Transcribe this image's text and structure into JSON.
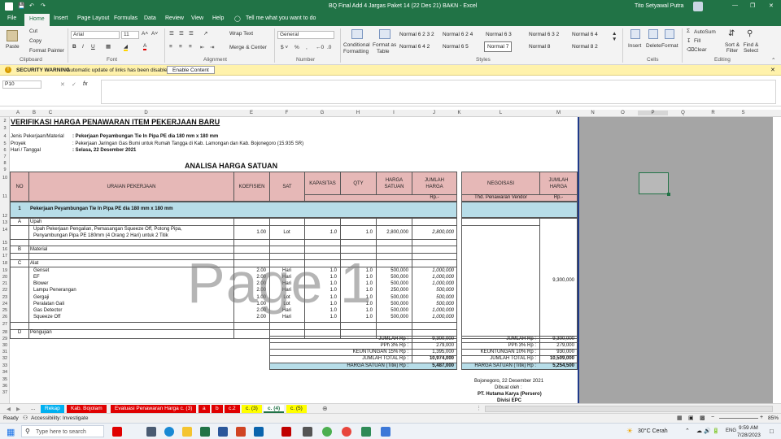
{
  "titlebar": {
    "doc_title": "BQ Final Add 4 Jargas Paket 14 (22 Des 21)  BAKN  -  Excel",
    "user": "Tito Setyawal Putra"
  },
  "menu": {
    "tabs": [
      "File",
      "Home",
      "Insert",
      "Page Layout",
      "Formulas",
      "Data",
      "Review",
      "View",
      "Help"
    ],
    "tell_me": "Tell me what you want to do"
  },
  "ribbon": {
    "paste": "Paste",
    "cut": "Cut",
    "copy": "Copy",
    "format_painter": "Format Painter",
    "clipboard": "Clipboard",
    "font_name": "Arial",
    "font_size": "11",
    "font": "Font",
    "wrap_text": "Wrap Text",
    "merge_center": "Merge & Center",
    "alignment": "Alignment",
    "number_format": "General",
    "number": "Number",
    "conditional": "Conditional",
    "formatting": "Formatting",
    "format_as": "Format as",
    "table": "Table",
    "styles_list": [
      "Normal 6 2 3 2",
      "Normal 6 2 4",
      "Normal 6 3",
      "Normal 6 3 2",
      "Normal 6 4",
      "Normal 6 4 2",
      "Normal 6 5",
      "Normal 7",
      "Normal 8",
      "Normal 8 2"
    ],
    "styles": "Styles",
    "insert": "Insert",
    "delete": "Delete",
    "format": "Format",
    "cells": "Cells",
    "autosum": "AutoSum",
    "fill": "Fill",
    "clear": "Clear",
    "sort_filter": "Sort & Filter",
    "find_select": "Find & Select",
    "editing": "Editing"
  },
  "warning": {
    "label": "SECURITY WARNING",
    "message": "Automatic update of links has been disabled",
    "button": "Enable Content"
  },
  "formula_bar": {
    "name_box": "P10",
    "fx": "fx",
    "content": ""
  },
  "columns": [
    "A",
    "B",
    "C",
    "D",
    "E",
    "F",
    "G",
    "H",
    "I",
    "J",
    "K",
    "L",
    "M",
    "N",
    "O",
    "P",
    "Q",
    "R",
    "S"
  ],
  "rows": [
    "2",
    "3",
    "4",
    "5",
    "6",
    "7",
    "8",
    "9",
    "10",
    "11",
    "12",
    "13",
    "14",
    "15",
    "16",
    "17",
    "18",
    "19",
    "20",
    "21",
    "22",
    "23",
    "24",
    "25",
    "26",
    "27",
    "28",
    "29",
    "30",
    "31",
    "32",
    "33",
    "34",
    "35",
    "36",
    "37"
  ],
  "doc": {
    "title": "VERIFIKASI HARGA PENAWARAN ITEM PEKERJAAN BARU",
    "jenis_label": "Jenis Pekerjaan/Material",
    "jenis_value": ": Pekerjaan Peyambungan Tie In Pipa PE dia 180 mm x 180 mm",
    "proyek_label": "Proyek",
    "proyek_value": ": Pekerjaan Jaringan Gas Bumi untuk Rumah Tangga di Kab. Lamongan dan Kab. Bojonegoro (15.935 SR)",
    "hari_label": "Hari / Tanggal",
    "hari_value": ": Selasa, 22 Desember 2021",
    "analisa": "ANALISA HARGA SATUAN",
    "h_no": "NO",
    "h_uraian": "URAIAN PEKERJAAN",
    "h_koef": "KOEFISIEN",
    "h_sat": "SAT",
    "h_kap": "KAPASITAS",
    "h_qty": "QTY",
    "h_harga": "HARGA SATUAN",
    "h_jumlah": "JUMLAH HARGA",
    "h_rp": "Rp.-",
    "h_negosiasi": "NEGOISASI",
    "h_jumlah2": "JUMLAH HARGA",
    "h_thd": "Thd. Penawaran Vendor",
    "h_rp2": "Rp.-",
    "item_no": "1",
    "item_name": "Pekerjaan Peyambungan Tie In Pipa PE dia 180 mm x 180 mm",
    "a_label": "A",
    "a_name": "Upah",
    "upah_desc1": "Upah Pekerjaan Pengalian, Pemasangan Squeeze Off, Potong Pipa,",
    "upah_desc2": "Penyambungan Pipa PE 180mm (4 Orang 2 Hari) untuk 2 Titik",
    "upah_koef": "1.00",
    "upah_sat": "Lot",
    "upah_kap": "1.0",
    "upah_qty": "1.0",
    "upah_harga": "2,800,000",
    "upah_jumlah": "2,800,000",
    "b_label": "B",
    "b_name": "Material",
    "c_label": "C",
    "c_name": "Alat",
    "d_label": "D",
    "d_name": "Pengujian",
    "alat": [
      {
        "name": "Genset",
        "koef": "2.00",
        "sat": "Hari",
        "kap": "1.0",
        "qty": "1.0",
        "harga": "500,000",
        "jumlah": "1,000,000"
      },
      {
        "name": "EF",
        "koef": "2.00",
        "sat": "Hari",
        "kap": "1.0",
        "qty": "1.0",
        "harga": "500,000",
        "jumlah": "1,000,000"
      },
      {
        "name": "Blower",
        "koef": "2.00",
        "sat": "Hari",
        "kap": "1.0",
        "qty": "1.0",
        "harga": "500,000",
        "jumlah": "1,000,000"
      },
      {
        "name": "Lampu Penerangan",
        "koef": "2.00",
        "sat": "Hari",
        "kap": "1.0",
        "qty": "1.0",
        "harga": "250,000",
        "jumlah": "500,000"
      },
      {
        "name": "Gergaji",
        "koef": "1.00",
        "sat": "Lot",
        "kap": "1.0",
        "qty": "1.0",
        "harga": "500,000",
        "jumlah": "500,000"
      },
      {
        "name": "Peralatan Gali",
        "koef": "1.00",
        "sat": "Lot",
        "kap": "1.0",
        "qty": "1.0",
        "harga": "500,000",
        "jumlah": "500,000"
      },
      {
        "name": "Gas Detector",
        "koef": "2.00",
        "sat": "Hari",
        "kap": "1.0",
        "qty": "1.0",
        "harga": "500,000",
        "jumlah": "1,000,000"
      },
      {
        "name": "Squeeze Off",
        "koef": "2.00",
        "sat": "Hari",
        "kap": "1.0",
        "qty": "1.0",
        "harga": "500,000",
        "jumlah": "1,000,000"
      }
    ],
    "nego_value": "9,300,000",
    "sum_left": [
      {
        "label": "JUMLAH Rp :",
        "value": "9,300,000"
      },
      {
        "label": "PPh 3% Rp :",
        "value": "279,000"
      },
      {
        "label": "KEUNTUNGAN 15% Rp :",
        "value": "1,395,000"
      },
      {
        "label": "JUMLAH TOTAL Rp :",
        "value": "10,974,000"
      },
      {
        "label": "HARGA SATUAN (Titik) Rp :",
        "value": "5,487,000"
      }
    ],
    "sum_right": [
      {
        "label": "JUMLAH Rp :",
        "value": "9,300,000"
      },
      {
        "label": "PPh 3% Rp :",
        "value": "279,000"
      },
      {
        "label": "KEUNTUNGAN 10% Rp :",
        "value": "930,000"
      },
      {
        "label": "JUMLAH TOTAL Rp :",
        "value": "10,509,000"
      },
      {
        "label": "HARGA SATUAN (Titik) Rp :",
        "value": "5,254,500"
      }
    ],
    "sign_date": "Bojonegoro, 22 Desember 2021",
    "sign_by": "Dibuat oleh :",
    "sign_company": "PT. Hutama Karya (Persero)",
    "sign_div": "Divisi EPC"
  },
  "watermark": "Page 1",
  "sheet_tabs": [
    "...",
    "Rekap",
    "Kab. Bojolam",
    "Evaluasi Penawaran Harga c. (3)",
    "a",
    "b",
    "c.2",
    "c. (3)",
    "c. (4)",
    "c. (5)"
  ],
  "status": {
    "ready": "Ready",
    "accessibility": "Accessibility: Investigate",
    "zoom": "85%"
  },
  "taskbar": {
    "search": "Type here to search",
    "weather": "30°C  Cerah",
    "time": "9:59 AM",
    "date": "7/28/2023",
    "lang": "ENG"
  }
}
